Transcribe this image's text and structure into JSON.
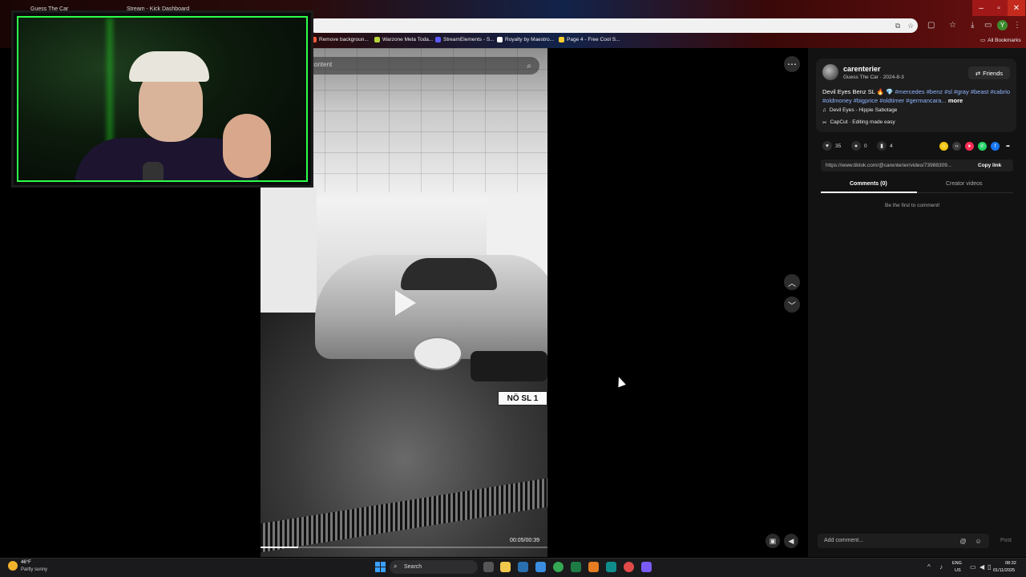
{
  "browser": {
    "tabs": [
      "Guess The Car",
      "Stream - Kick Dashboard"
    ],
    "bookmarks": [
      {
        "label": "Remove backgroun...",
        "color": "#ff5a3c"
      },
      {
        "label": "Warzone Meta Toda...",
        "color": "#b6d43a"
      },
      {
        "label": "StreamElements - S...",
        "color": "#5b5bff"
      },
      {
        "label": "Royalty by Maestro...",
        "color": "#ffffff"
      },
      {
        "label": "Page 4 - Free Cool S...",
        "color": "#ffcf2e"
      }
    ],
    "all_bookmarks": "All Bookmarks",
    "profile_initial": "Y",
    "window_controls": {
      "min": "–",
      "max": "▫",
      "close": "✕"
    }
  },
  "tiktok": {
    "search_placeholder": "content",
    "plate": "NÖ SL 1",
    "video_time": "00:05/00:39",
    "progress_percent": 13,
    "author": {
      "username": "carenterier",
      "nickname_date": "Guess The Car · 2024-8-3",
      "friends_label": "Friends"
    },
    "caption": {
      "text": "Devil Eyes Benz SL",
      "emojis": "🔥 💎",
      "tags": [
        "#mercedes",
        "#benz",
        "#sl",
        "#gray",
        "#beast",
        "#cabrio",
        "#oldmoney",
        "#bigprice",
        "#oldtimer",
        "#germancara..."
      ],
      "more": "more"
    },
    "music": "Devil Eyes - Hippie Sabotage",
    "capcut": "CapCut · Editing made easy",
    "stats": {
      "likes": "35",
      "comments": "0",
      "saves": "4"
    },
    "share_colors": [
      "#f2c511",
      "#3a3a3a",
      "#fe2c55",
      "#25d366",
      "#1877f2"
    ],
    "link": "https://www.tiktok.com/@carenterier/video/73988309...",
    "copy_link": "Copy link",
    "tabs": {
      "comments": "Comments (0)",
      "creator": "Creator videos"
    },
    "empty_comments": "Be the first to comment!",
    "comment_placeholder": "Add comment...",
    "post": "Post"
  },
  "taskbar": {
    "temp": "46°F",
    "weather": "Partly sunny",
    "search": "Search",
    "lang": "ENG",
    "region": "US",
    "time": "08:32",
    "date": "01/11/2025"
  }
}
